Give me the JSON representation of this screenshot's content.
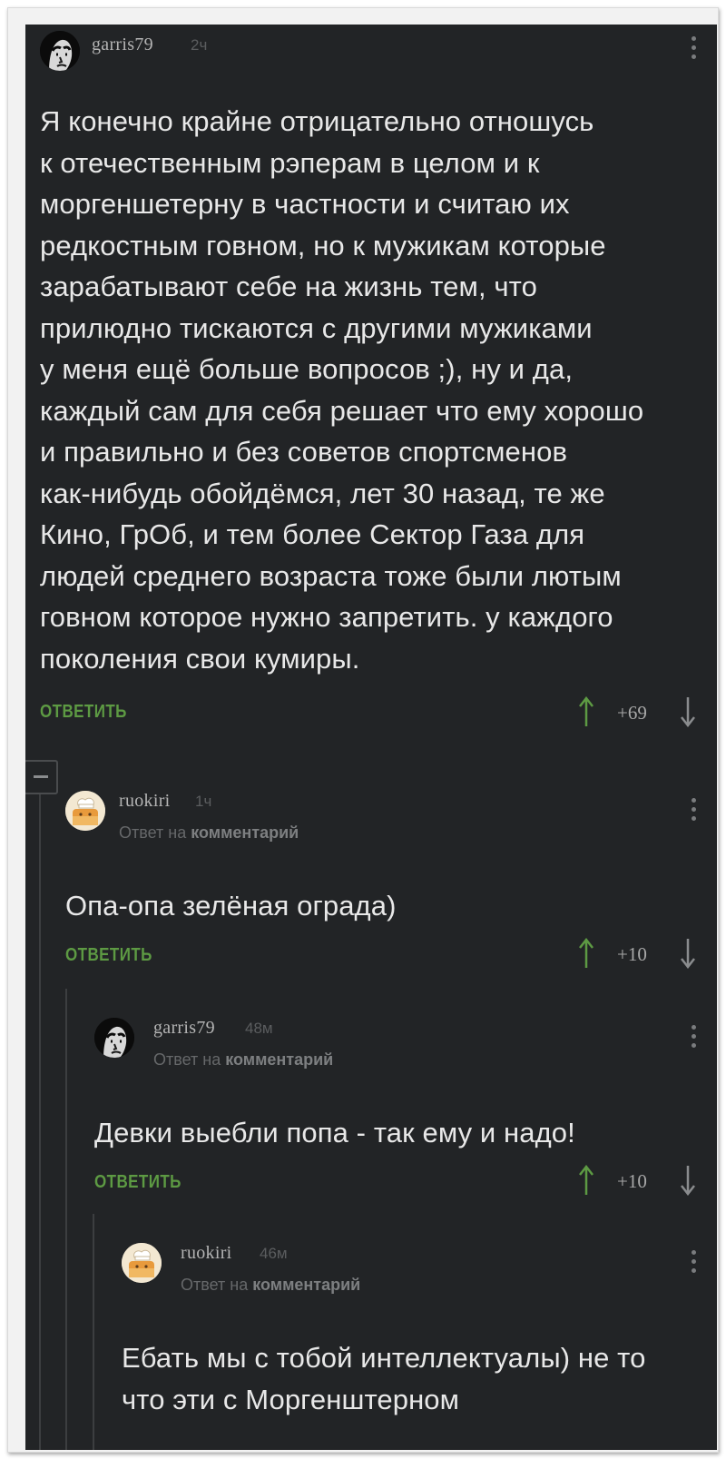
{
  "comments": [
    {
      "username": "garris79",
      "time": "2ч",
      "avatar_icon": "avatar-dark-face",
      "text": "Я конечно крайне отрицательно отношусь\nк отечественным рэперам в целом и к\nморгеншетерну в частности и считаю их\nредкостным говном, но к мужикам которые\nзарабатывают себе на жизнь тем, что\nприлюдно тискаются с другими мужиками\nу меня ещё больше вопросов ;), ну и да,\nкаждый сам для себя решает что ему хорошо\nи правильно и без советов спортсменов\nкак-нибудь обойдёмся, лет 30 назад, те же\nКино, ГрОб, и тем более Сектор Газа для\nлюдей среднего возраста тоже были лютым\nговном которое нужно запретить. у каждого\nпоколения свои кумиры.",
      "reply_label": "ОТВЕТИТЬ",
      "score": "+69"
    },
    {
      "username": "ruokiri",
      "time": "1ч",
      "avatar_icon": "avatar-cook-hat",
      "reply_prefix": "Ответ на",
      "reply_target": "комментарий",
      "text": "Опа-опа зелёная ограда)",
      "reply_label": "ОТВЕТИТЬ",
      "score": "+10"
    },
    {
      "username": "garris79",
      "time": "48м",
      "avatar_icon": "avatar-dark-face",
      "reply_prefix": "Ответ на",
      "reply_target": "комментарий",
      "text": "Девки выебли попа - так ему и надо!",
      "reply_label": "ОТВЕТИТЬ",
      "score": "+10"
    },
    {
      "username": "ruokiri",
      "time": "46м",
      "avatar_icon": "avatar-cook-hat",
      "reply_prefix": "Ответ на",
      "reply_target": "комментарий",
      "text": "Ебать мы с тобой интеллектуалы) не то\nчто эти с Моргенштерном"
    }
  ],
  "colors": {
    "background": "#222426",
    "text": "#e8e8e8",
    "reply_button": "#5d9a43",
    "vote_up": "#5d9a43",
    "muted": "#66686a"
  },
  "icons": [
    "more-dots-icon",
    "upvote-arrow-icon",
    "downvote-arrow-icon",
    "collapse-thread-icon"
  ]
}
